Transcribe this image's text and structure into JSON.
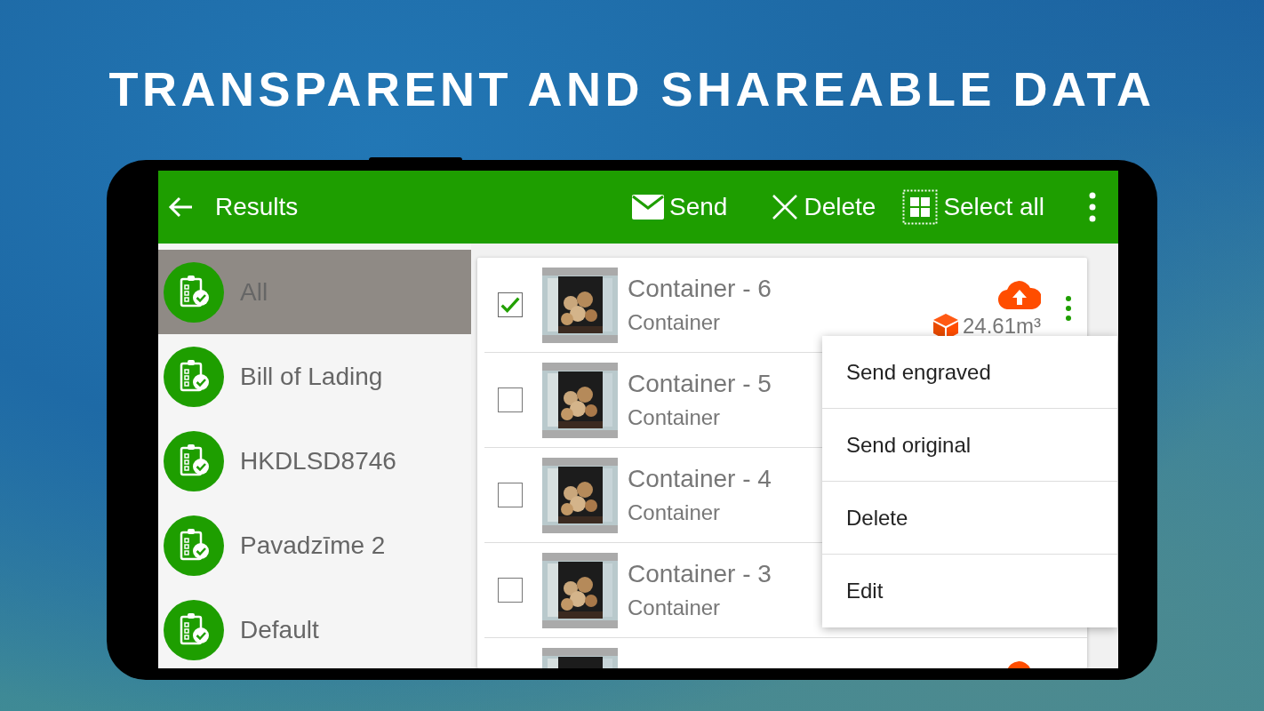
{
  "headline": "TRANSPARENT AND SHAREABLE DATA",
  "app_bar": {
    "title": "Results",
    "actions": [
      {
        "kind": "send",
        "label": "Send"
      },
      {
        "kind": "delete",
        "label": "Delete"
      },
      {
        "kind": "select_all",
        "label": "Select all"
      }
    ]
  },
  "sidebar": {
    "items": [
      {
        "label": "All",
        "selected": true
      },
      {
        "label": "Bill of Lading",
        "selected": false
      },
      {
        "label": "HKDLSD8746",
        "selected": false
      },
      {
        "label": "Pavadzīme 2",
        "selected": false
      },
      {
        "label": "Default",
        "selected": false
      }
    ]
  },
  "rows": [
    {
      "title": "Container - 6",
      "subtitle": "Container",
      "checked": true,
      "uploaded": true,
      "volume": "24.61m³",
      "menu_button": true
    },
    {
      "title": "Container - 5",
      "subtitle": "Container",
      "checked": false
    },
    {
      "title": "Container - 4",
      "subtitle": "Container",
      "checked": false
    },
    {
      "title": "Container - 3",
      "subtitle": "Container",
      "checked": false
    },
    {
      "uploaded": true
    }
  ],
  "context_menu": [
    "Send engraved",
    "Send original",
    "Delete",
    "Edit"
  ]
}
